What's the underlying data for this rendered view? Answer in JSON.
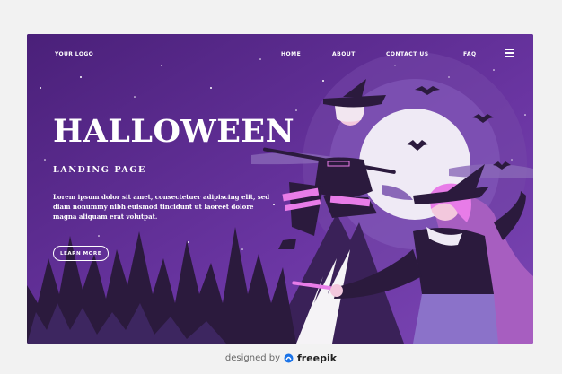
{
  "header": {
    "logo": "YOUR LOGO",
    "nav": [
      {
        "label": "HOME"
      },
      {
        "label": "ABOUT"
      },
      {
        "label": "CONTACT US"
      },
      {
        "label": "FAQ"
      }
    ],
    "menu_icon": "hamburger-menu-icon"
  },
  "hero": {
    "title": "HALLOWEEN",
    "subtitle": "LANDING PAGE",
    "body": "Lorem ipsum dolor sit amet, consectetuer adipiscing elit, sed diam nonummy nibh euismod tincidunt ut laoreet dolore magna aliquam erat volutpat.",
    "cta": "LEARN MORE"
  },
  "footer": {
    "credit_text": "designed by",
    "brand": "freepik",
    "brand_icon": "freepik-logo-icon"
  },
  "colors": {
    "background": "#5b2a8e",
    "accent_pink": "#e87ce8",
    "moon": "#efeaf5",
    "dark": "#2b1a3d"
  }
}
